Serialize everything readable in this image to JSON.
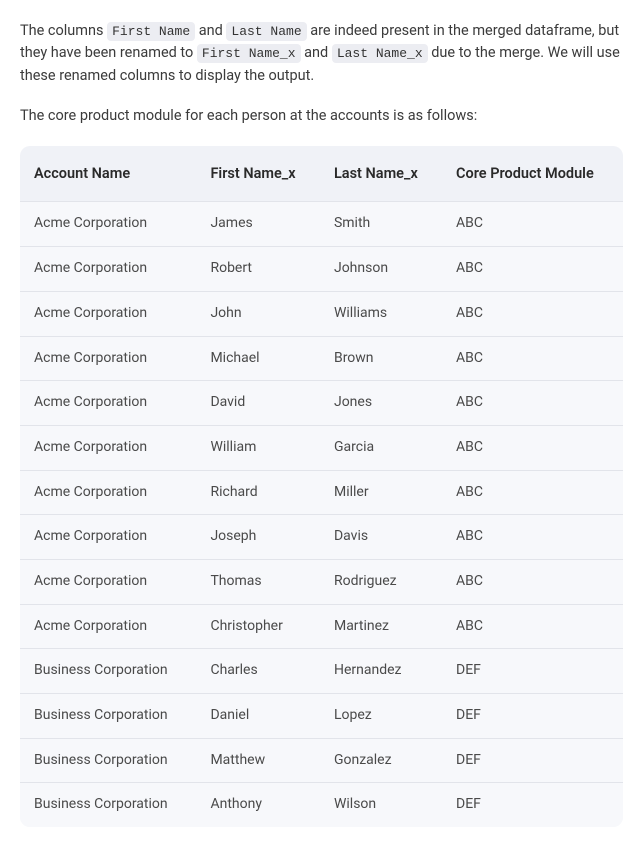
{
  "intro": {
    "prefix": "The columns ",
    "code1": "First Name",
    "mid1": " and ",
    "code2": "Last Name",
    "mid2": " are indeed present in the merged dataframe, but they have been renamed to ",
    "code3": "First Name_x",
    "mid3": " and ",
    "code4": "Last Name_x",
    "suffix": " due to the merge. We will use these renamed columns to display the output."
  },
  "lead": "The core product module for each person at the accounts is as follows:",
  "table": {
    "headers": [
      "Account Name",
      "First Name_x",
      "Last Name_x",
      "Core Product Module"
    ],
    "rows": [
      [
        "Acme Corporation",
        "James",
        "Smith",
        "ABC"
      ],
      [
        "Acme Corporation",
        "Robert",
        "Johnson",
        "ABC"
      ],
      [
        "Acme Corporation",
        "John",
        "Williams",
        "ABC"
      ],
      [
        "Acme Corporation",
        "Michael",
        "Brown",
        "ABC"
      ],
      [
        "Acme Corporation",
        "David",
        "Jones",
        "ABC"
      ],
      [
        "Acme Corporation",
        "William",
        "Garcia",
        "ABC"
      ],
      [
        "Acme Corporation",
        "Richard",
        "Miller",
        "ABC"
      ],
      [
        "Acme Corporation",
        "Joseph",
        "Davis",
        "ABC"
      ],
      [
        "Acme Corporation",
        "Thomas",
        "Rodriguez",
        "ABC"
      ],
      [
        "Acme Corporation",
        "Christopher",
        "Martinez",
        "ABC"
      ],
      [
        "Business Corporation",
        "Charles",
        "Hernandez",
        "DEF"
      ],
      [
        "Business Corporation",
        "Daniel",
        "Lopez",
        "DEF"
      ],
      [
        "Business Corporation",
        "Matthew",
        "Gonzalez",
        "DEF"
      ],
      [
        "Business Corporation",
        "Anthony",
        "Wilson",
        "DEF"
      ]
    ]
  }
}
